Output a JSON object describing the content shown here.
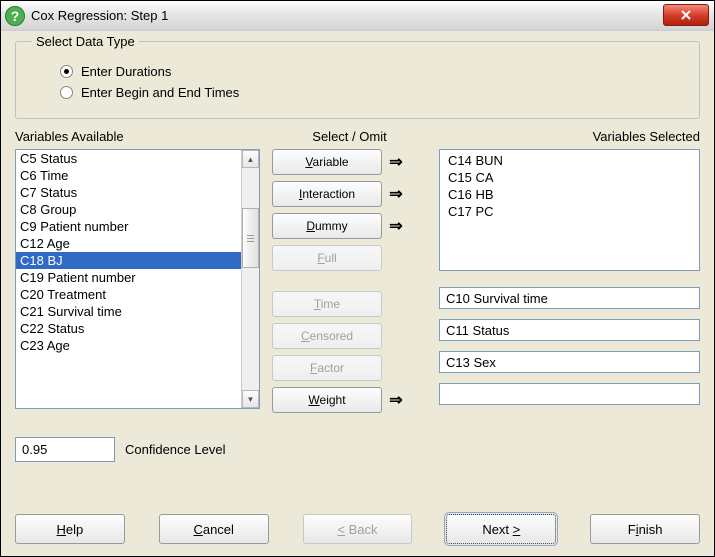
{
  "window": {
    "title": "Cox Regression: Step 1"
  },
  "dataType": {
    "groupLabel": "Select Data Type",
    "opt1": "Enter Durations",
    "opt2": "Enter Begin and End Times"
  },
  "labels": {
    "variablesAvailable": "Variables Available",
    "selectOmit": "Select / Omit",
    "variablesSelected": "Variables Selected",
    "confidence": "Confidence Level"
  },
  "available": {
    "items": [
      "C5 Status",
      "C6 Time",
      "C7 Status",
      "C8 Group",
      "C9 Patient number",
      "C12 Age",
      "C18 BJ",
      "C19 Patient number",
      "C20 Treatment",
      "C21 Survival time",
      "C22 Status",
      "C23 Age"
    ],
    "selectedIndex": 6
  },
  "selected": {
    "items": [
      "C14 BUN",
      "C15 CA",
      "C16 HB",
      "C17 PC"
    ]
  },
  "midButtons": {
    "variable": "Variable",
    "interaction": "Interaction",
    "dummy": "Dummy",
    "full": "Full",
    "time": "Time",
    "censored": "Censored",
    "factor": "Factor",
    "weight": "Weight"
  },
  "fields": {
    "time": "C10 Survival time",
    "censored": "C11 Status",
    "factor": "C13 Sex",
    "weight": ""
  },
  "confidence": "0.95",
  "buttons": {
    "help": "Help",
    "cancel": "Cancel",
    "back": "Back",
    "next": "Next",
    "finish": "Finish"
  }
}
